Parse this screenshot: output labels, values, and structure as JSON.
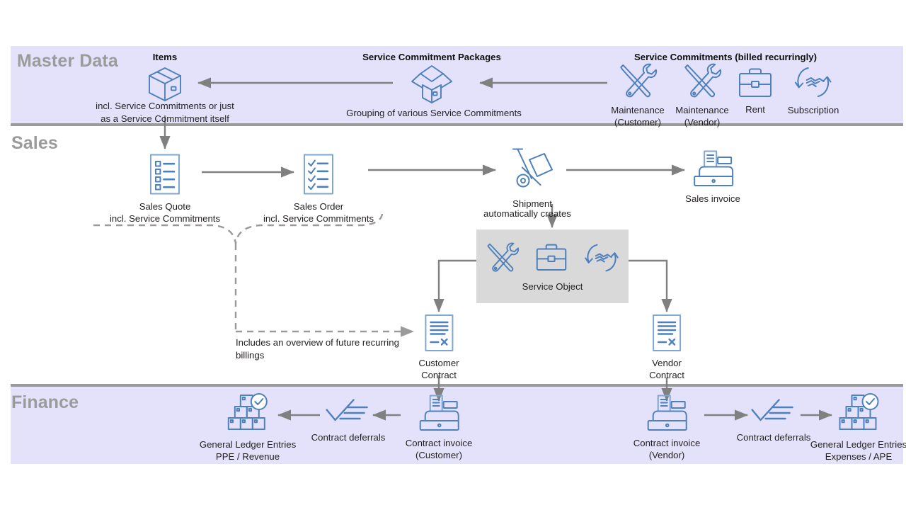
{
  "theme": {
    "band_bg": "#E4E2FA",
    "band_rule": "#9a9a9a",
    "band_title_color": "#9b9b9b",
    "icon_blue": "#4E80BC",
    "icon_blue_light": "#7FA6D0",
    "arrow_gray": "#808080",
    "dashed_gray": "#9a9a9a",
    "service_object_bg": "#D9D9D9",
    "text_color": "#231f20"
  },
  "bands": [
    {
      "id": "master-data",
      "title": "Master Data"
    },
    {
      "id": "sales",
      "title": "Sales"
    },
    {
      "id": "finance",
      "title": "Finance"
    }
  ],
  "master_data": {
    "headers": [
      {
        "id": "items",
        "text": "Items"
      },
      {
        "id": "packages",
        "text": "Service Commitment Packages"
      },
      {
        "id": "commitments",
        "text": "Service Commitments (billed recurringly)"
      }
    ],
    "items": {
      "icon": "box-icon",
      "note": "incl. Service Commitments or just\nas a Service Commitment itself"
    },
    "packages": {
      "icon": "open-box-icon",
      "note": "Grouping of various Service Commitments"
    },
    "commitments": [
      {
        "icon": "tools-icon",
        "label": "Maintenance\n(Customer)"
      },
      {
        "icon": "tools-icon",
        "label": "Maintenance\n(Vendor)"
      },
      {
        "icon": "briefcase-icon",
        "label": "Rent"
      },
      {
        "icon": "subscription-cycle-icon",
        "label": "Subscription"
      }
    ]
  },
  "sales": {
    "nodes": [
      {
        "id": "sales-quote",
        "icon": "checklist-square-icon",
        "label": "Sales Quote\nincl. Service Commitments"
      },
      {
        "id": "sales-order",
        "icon": "checklist-check-icon",
        "label": "Sales Order\nincl. Service Commitments"
      },
      {
        "id": "shipment",
        "icon": "hand-truck-icon",
        "label": "Shipment"
      },
      {
        "id": "sales-invoice",
        "icon": "cash-register-icon",
        "label": "Sales invoice"
      },
      {
        "id": "customer-contract",
        "icon": "contract-document-icon",
        "label": "Customer\nContract"
      },
      {
        "id": "vendor-contract",
        "icon": "contract-document-icon",
        "label": "Vendor\nContract"
      }
    ],
    "service_object": {
      "label": "Service Object",
      "icons": [
        "tools-icon",
        "briefcase-icon",
        "subscription-cycle-icon"
      ]
    },
    "annotations": [
      {
        "id": "automatically-creates",
        "text": "automatically creates"
      },
      {
        "id": "future-recurring-billings",
        "text": "Includes an overview of future recurring\nbillings"
      }
    ]
  },
  "finance": {
    "nodes": [
      {
        "id": "gl-entries-revenue",
        "icon": "ledger-blocks-icon",
        "label": "General Ledger Entries\nPPE / Revenue"
      },
      {
        "id": "contract-deferrals-customer",
        "icon": "deferrals-check-icon",
        "label": "Contract deferrals"
      },
      {
        "id": "contract-invoice-customer",
        "icon": "cash-register-icon",
        "label": "Contract invoice\n(Customer)"
      },
      {
        "id": "contract-invoice-vendor",
        "icon": "cash-register-icon",
        "label": "Contract invoice\n(Vendor)"
      },
      {
        "id": "contract-deferrals-vendor",
        "icon": "deferrals-check-icon",
        "label": "Contract deferrals"
      },
      {
        "id": "gl-entries-expenses",
        "icon": "ledger-blocks-icon",
        "label": "General Ledger Entries\nExpenses / APE"
      }
    ]
  }
}
